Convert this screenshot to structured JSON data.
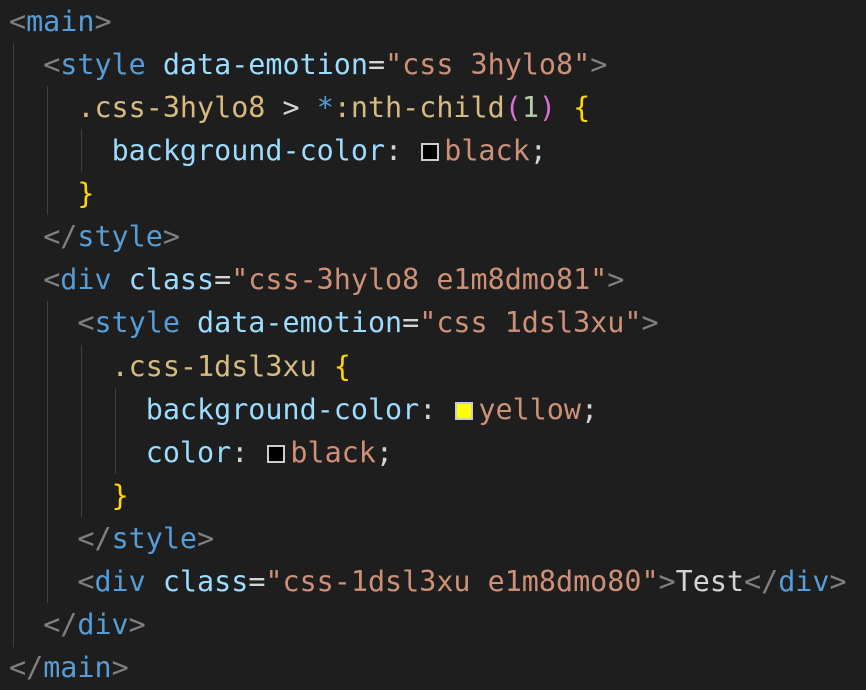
{
  "code": {
    "l1": {
      "open": "<",
      "tag": "main",
      "close": ">"
    },
    "l2": {
      "open": "<",
      "tag": "style",
      "attr": "data-emotion",
      "eq": "=",
      "value": "\"css 3hylo8\"",
      "close": ">"
    },
    "l3": {
      "selector": ".css-3hylo8",
      "combinator": " > ",
      "universal": "*",
      "pseudo": ":nth-child",
      "paren_open": "(",
      "num": "1",
      "paren_close": ")",
      "brace": "{"
    },
    "l4": {
      "prop": "background-color",
      "colon": ": ",
      "value": "black",
      "semi": ";",
      "swatch_color": "#000000"
    },
    "l5": {
      "brace": "}"
    },
    "l6": {
      "open": "</",
      "tag": "style",
      "close": ">"
    },
    "l7": {
      "open": "<",
      "tag": "div",
      "attr": "class",
      "eq": "=",
      "value": "\"css-3hylo8 e1m8dmo81\"",
      "close": ">"
    },
    "l8": {
      "open": "<",
      "tag": "style",
      "attr": "data-emotion",
      "eq": "=",
      "value": "\"css 1dsl3xu\"",
      "close": ">"
    },
    "l9": {
      "selector": ".css-1dsl3xu",
      "brace": "{"
    },
    "l10": {
      "prop": "background-color",
      "colon": ": ",
      "value": "yellow",
      "semi": ";",
      "swatch_color": "#ffff00"
    },
    "l11": {
      "prop": "color",
      "colon": ": ",
      "value": "black",
      "semi": ";",
      "swatch_color": "#000000"
    },
    "l12": {
      "brace": "}"
    },
    "l13": {
      "open": "</",
      "tag": "style",
      "close": ">"
    },
    "l14": {
      "open": "<",
      "tag": "div",
      "attr": "class",
      "eq": "=",
      "value": "\"css-1dsl3xu e1m8dmo80\"",
      "close": ">",
      "text": "Test",
      "end_open": "</",
      "end_tag": "div",
      "end_close": ">"
    },
    "l15": {
      "open": "</",
      "tag": "div",
      "close": ">"
    },
    "l16": {
      "open": "</",
      "tag": "main",
      "close": ">"
    }
  }
}
